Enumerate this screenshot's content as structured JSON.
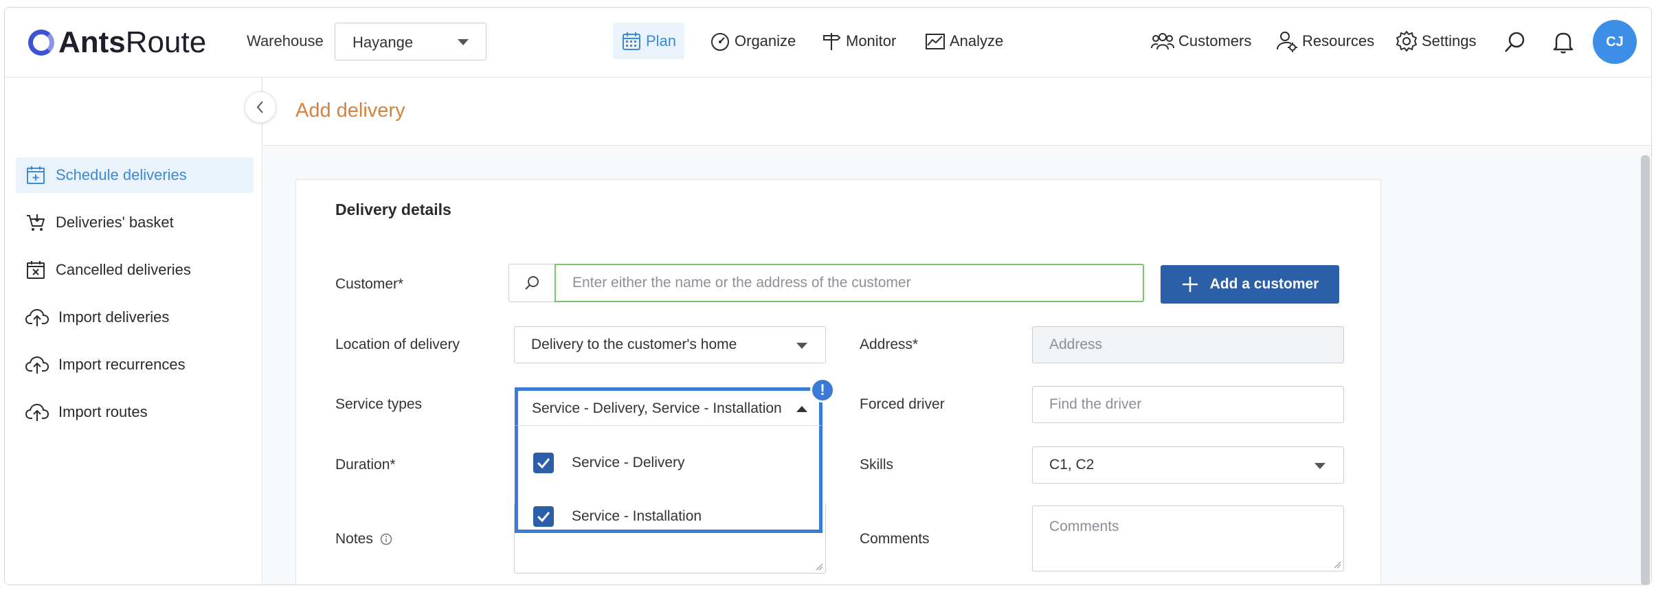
{
  "app": {
    "brand_strong": "Ants",
    "brand_light": "Route"
  },
  "header": {
    "warehouse_label": "Warehouse",
    "warehouse_value": "Hayange",
    "nav": [
      {
        "label": "Plan",
        "icon": "calendar-icon",
        "active": true
      },
      {
        "label": "Organize",
        "icon": "gauge-icon",
        "active": false
      },
      {
        "label": "Monitor",
        "icon": "signpost-icon",
        "active": false
      },
      {
        "label": "Analyze",
        "icon": "chart-icon",
        "active": false
      }
    ],
    "right_nav": [
      {
        "label": "Customers",
        "icon": "customers-icon"
      },
      {
        "label": "Resources",
        "icon": "resources-icon"
      },
      {
        "label": "Settings",
        "icon": "gear-icon"
      }
    ],
    "avatar_initials": "CJ"
  },
  "sidebar": {
    "items": [
      {
        "label": "Schedule deliveries",
        "icon": "calendar-plus-icon",
        "active": true
      },
      {
        "label": "Deliveries' basket",
        "icon": "basket-icon",
        "active": false
      },
      {
        "label": "Cancelled deliveries",
        "icon": "calendar-x-icon",
        "active": false
      },
      {
        "label": "Import deliveries",
        "icon": "cloud-upload-icon",
        "active": false
      },
      {
        "label": "Import recurrences",
        "icon": "cloud-upload-icon",
        "active": false
      },
      {
        "label": "Import routes",
        "icon": "cloud-upload-icon",
        "active": false
      }
    ]
  },
  "page": {
    "title": "Add delivery"
  },
  "form": {
    "section_title": "Delivery details",
    "customer_label": "Customer*",
    "customer_placeholder": "Enter either the name or the address of the customer",
    "add_customer_label": "Add a customer",
    "location_label": "Location of delivery",
    "location_value": "Delivery to the customer's home",
    "address_label": "Address*",
    "address_placeholder": "Address",
    "service_types_label": "Service types",
    "service_types_value": "Service - Delivery, Service - Installation",
    "service_options": [
      {
        "label": "Service - Delivery",
        "checked": true
      },
      {
        "label": "Service - Installation",
        "checked": true
      }
    ],
    "forced_driver_label": "Forced driver",
    "forced_driver_placeholder": "Find the driver",
    "duration_label": "Duration*",
    "skills_label": "Skills",
    "skills_value": "C1, C2",
    "notes_label": "Notes",
    "comments_label": "Comments",
    "comments_placeholder": "Comments",
    "alert_badge": "!"
  },
  "colors": {
    "primary": "#2b5fa8",
    "accent": "#3a7bd5",
    "title_orange": "#d4823e",
    "active_bg": "#eaf2fb",
    "valid_green": "#7cc26a"
  }
}
